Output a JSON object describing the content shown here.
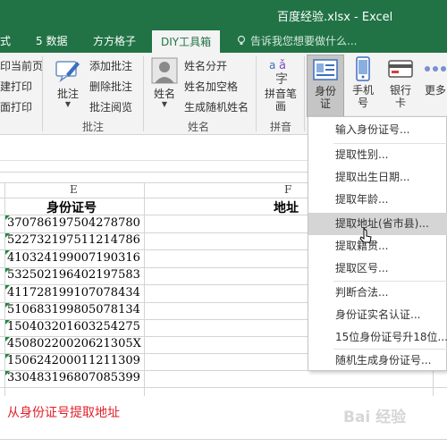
{
  "window": {
    "title": "百度经验.xlsx - Excel"
  },
  "tabs": [
    {
      "label": "式"
    },
    {
      "label": "5 数据"
    },
    {
      "label": "方方格子"
    },
    {
      "label": "DIY工具箱"
    }
  ],
  "tell_me": "告诉我您想要做什么...",
  "ribbon": {
    "left_items": [
      "印当前页",
      "建打印",
      "面打印"
    ],
    "annotation": {
      "big": "批注",
      "items": [
        "添加批注",
        "删除批注",
        "批注阅览"
      ],
      "group": "批注"
    },
    "name": {
      "big": "姓名",
      "items": [
        "姓名分开",
        "姓名加空格",
        "生成随机姓名"
      ],
      "group": "姓名"
    },
    "pinyin": {
      "big_line1": "拼音笔",
      "big_line2": "画",
      "group": "拼音"
    },
    "idcard": {
      "line1": "身份",
      "line2": "证"
    },
    "phone": {
      "line1": "手机",
      "line2": "号"
    },
    "bank": {
      "line1": "银行",
      "line2": "卡"
    },
    "more": {
      "line1": "更多"
    }
  },
  "grid": {
    "col_e": "E",
    "col_f": "F",
    "header_e": "身份证号",
    "header_f": "地址",
    "ids": [
      "370786197504278780",
      "522732197511214786",
      "410324199007190316",
      "532502196402197583",
      "411728199107078434",
      "510683199805078134",
      "150403201603254275",
      "450802200206213​05X",
      "150624200011211309",
      "330483196807085399"
    ],
    "note": "从身份证号提取地址"
  },
  "menu": {
    "items": [
      "输入身份证号...",
      "提取性别...",
      "提取出生日期...",
      "提取年龄...",
      "提取地址(省市县)...",
      "提取籍贯...",
      "提取区号...",
      "判断合法...",
      "身份证实名认证...",
      "15位身份证号升18位...",
      "随机生成身份证号..."
    ],
    "hover_index": 4
  },
  "watermark": "Bai 经验",
  "colors": {
    "excel_green": "#217346",
    "note_red": "#e0202a",
    "menu_hover": "#d5d5d5"
  }
}
